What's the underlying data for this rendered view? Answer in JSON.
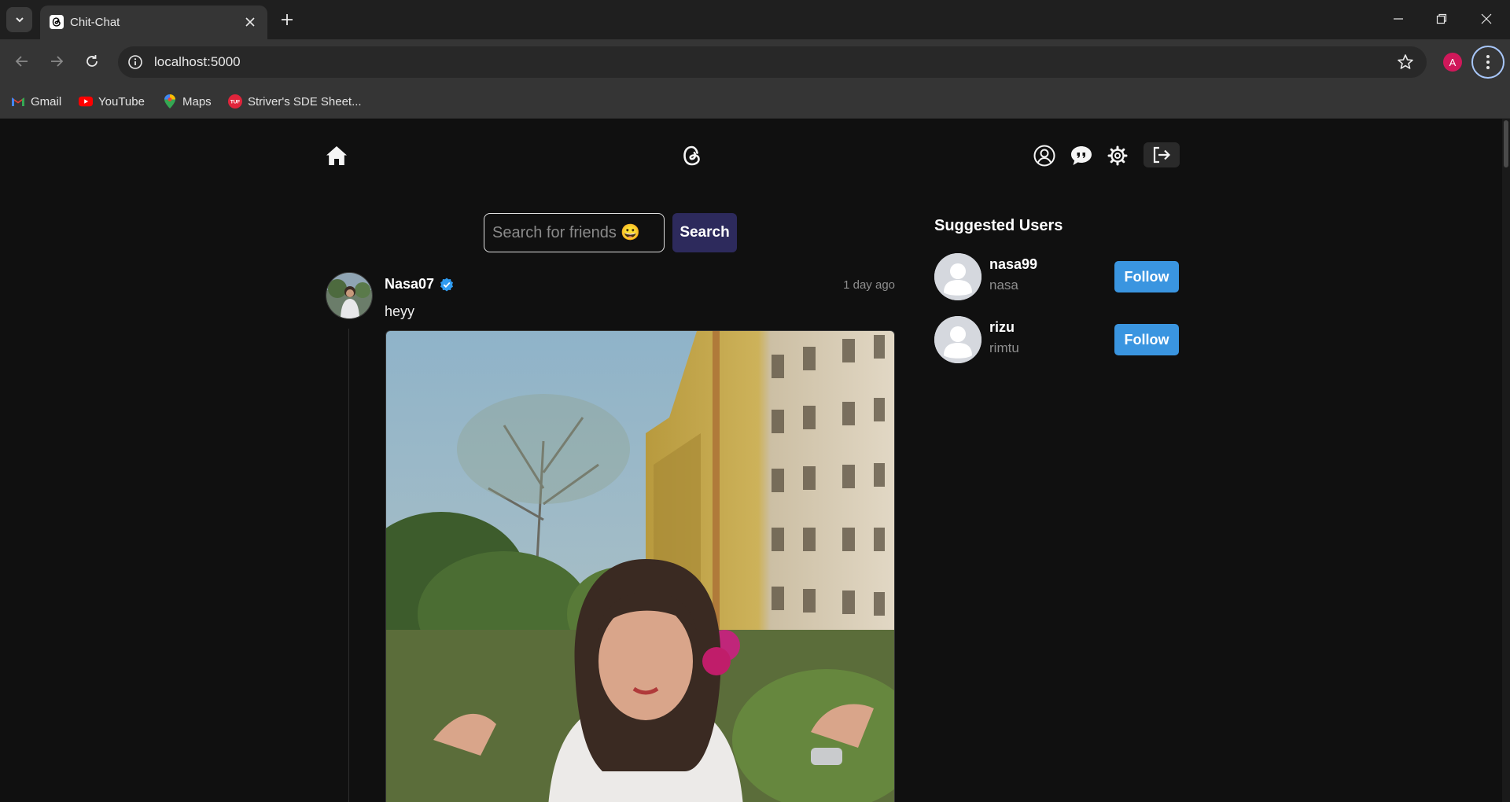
{
  "browser": {
    "tab_title": "Chit-Chat",
    "url": "localhost:5000",
    "profile_initial": "A",
    "bookmarks": [
      {
        "label": "Gmail",
        "icon": "gmail-icon"
      },
      {
        "label": "YouTube",
        "icon": "youtube-icon"
      },
      {
        "label": "Maps",
        "icon": "maps-icon"
      },
      {
        "label": "Striver's SDE Sheet...",
        "icon": "tuf-icon"
      }
    ]
  },
  "search": {
    "placeholder": "Search for friends 😀",
    "button_label": "Search"
  },
  "post": {
    "username": "Nasa07",
    "verified": true,
    "time_ago": "1 day ago",
    "text": "heyy"
  },
  "suggested": {
    "title": "Suggested Users",
    "users": [
      {
        "username": "nasa99",
        "name": "nasa",
        "button": "Follow"
      },
      {
        "username": "rizu",
        "name": "rimtu",
        "button": "Follow"
      }
    ]
  },
  "colors": {
    "page_bg": "#101010",
    "follow_button": "#3a95e0",
    "search_button": "#2d2a5c",
    "verified": "#2f9bf0"
  }
}
